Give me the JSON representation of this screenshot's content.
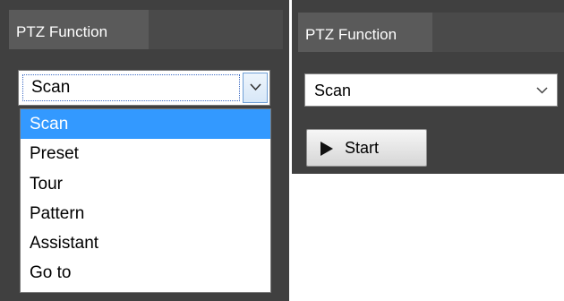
{
  "left_panel": {
    "tab_label": "PTZ Function",
    "select": {
      "value": "Scan",
      "options": [
        "Scan",
        "Preset",
        "Tour",
        "Pattern",
        "Assistant",
        "Go to"
      ],
      "highlighted_option": "Scan"
    }
  },
  "right_panel": {
    "tab_label": "PTZ Function",
    "select_value": "Scan",
    "start_label": "Start"
  },
  "colors": {
    "panel_bg": "#404040",
    "tab_bg": "#5a5a5a",
    "selection": "#3399ff"
  },
  "icons": {
    "dropdown_arrow": "chevron-down-icon",
    "start": "play-icon"
  }
}
